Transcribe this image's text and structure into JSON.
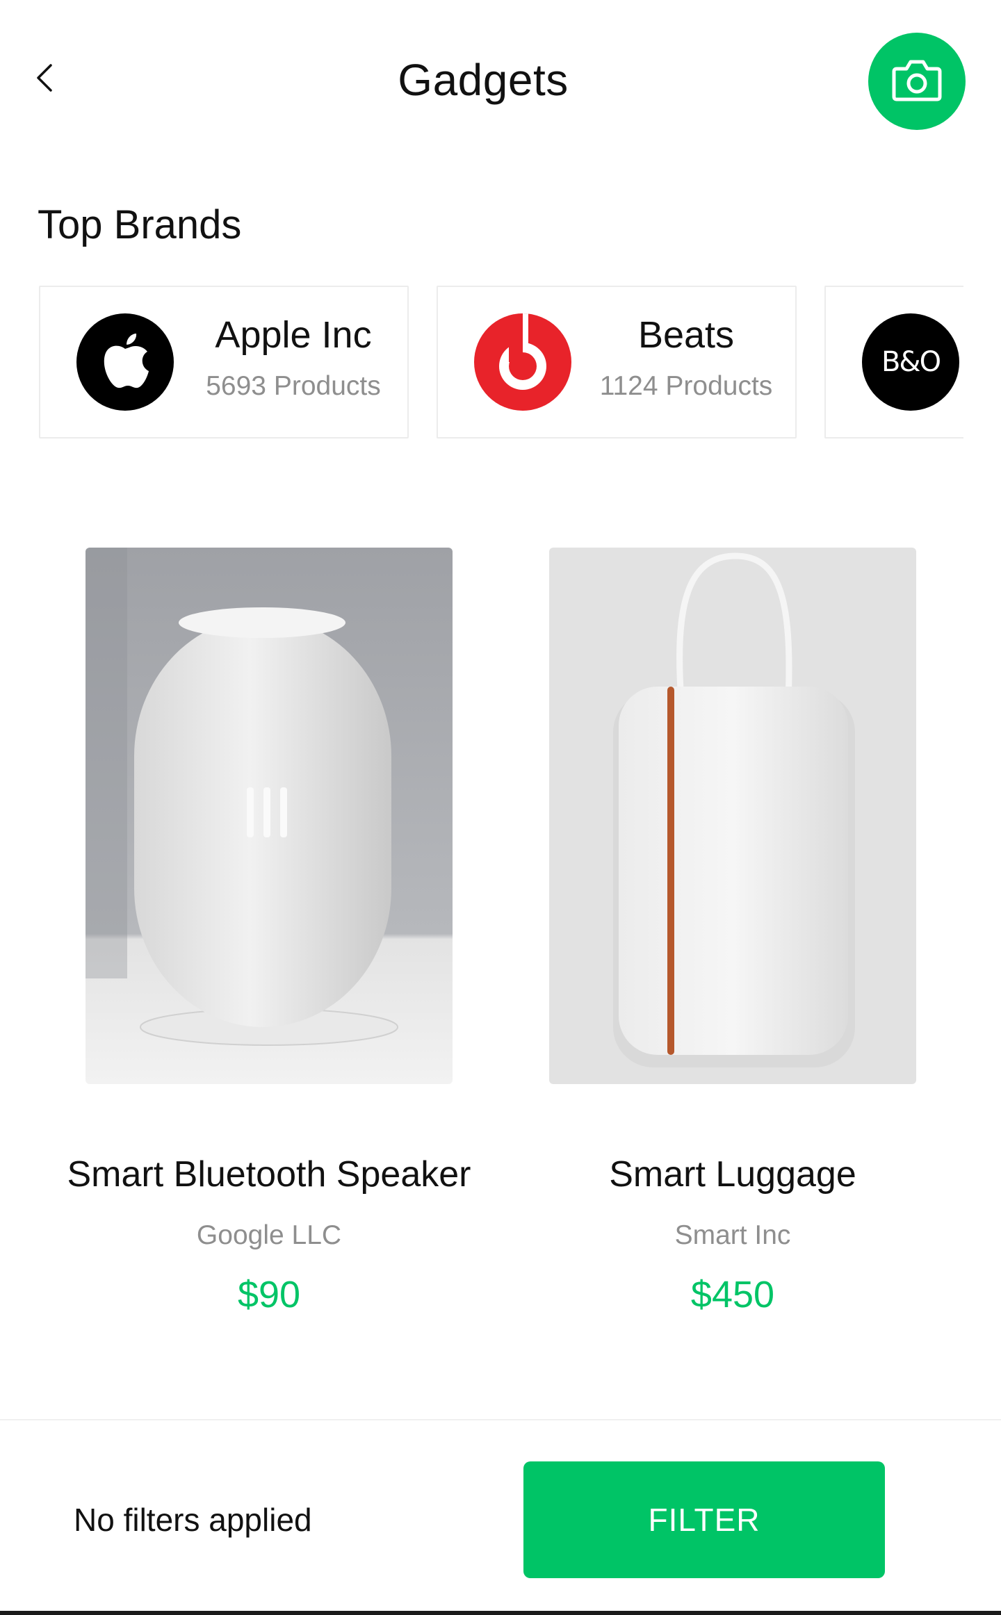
{
  "header": {
    "title": "Gadgets",
    "back_icon": "chevron-left-icon",
    "camera_icon": "camera-icon"
  },
  "top_brands": {
    "title": "Top Brands",
    "items": [
      {
        "name": "Apple Inc",
        "count": "5693 Products",
        "logo": "apple-logo",
        "logo_bg": "#000000"
      },
      {
        "name": "Beats",
        "count": "1124 Products",
        "logo": "beats-logo",
        "logo_bg": "#e8232a"
      },
      {
        "name": "B&O",
        "count": "",
        "logo": "bang-olufsen-logo",
        "logo_bg": "#000000",
        "logo_text": "B&O"
      }
    ]
  },
  "products": [
    {
      "name": "Smart Bluetooth Speaker",
      "brand": "Google LLC",
      "price": "$90"
    },
    {
      "name": "Smart Luggage",
      "brand": "Smart Inc",
      "price": "$450"
    }
  ],
  "bottom_bar": {
    "status": "No filters applied",
    "filter_label": "FILTER"
  },
  "colors": {
    "accent": "#00c466",
    "muted_text": "#8e8e8e",
    "card_border": "#ececec"
  }
}
